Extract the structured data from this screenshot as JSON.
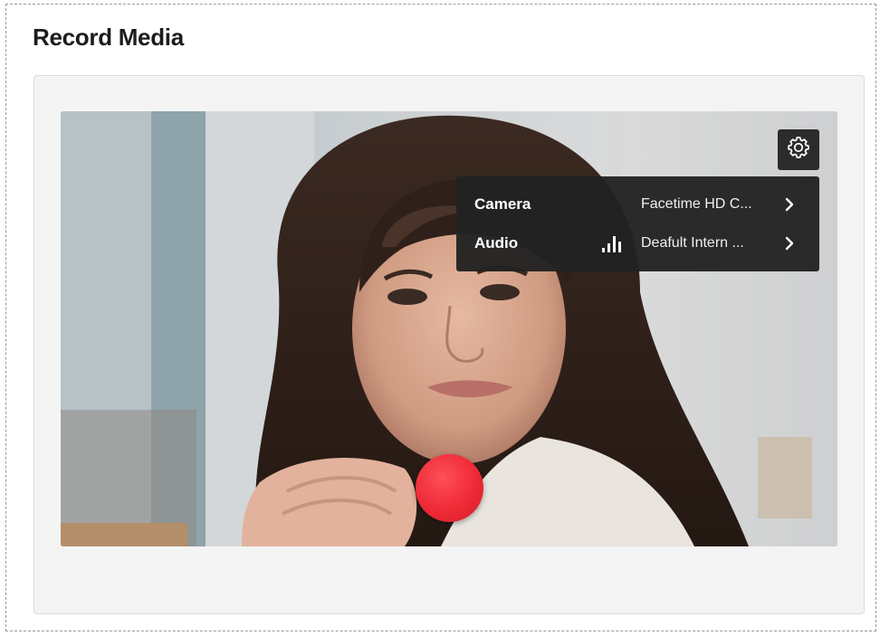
{
  "page": {
    "title": "Record Media"
  },
  "settings": {
    "icon": "gear-icon",
    "rows": [
      {
        "label": "Camera",
        "value": "Facetime HD C...",
        "icon": "chevron-right-icon"
      },
      {
        "label": "Audio",
        "value": "Deafult Intern ...",
        "level_icon": "audio-level-icon",
        "icon": "chevron-right-icon"
      }
    ]
  },
  "record": {
    "icon": "record-icon",
    "color": "#ee2a36"
  },
  "colors": {
    "menu_background": "#222222",
    "card_background": "#f4f4f5"
  }
}
